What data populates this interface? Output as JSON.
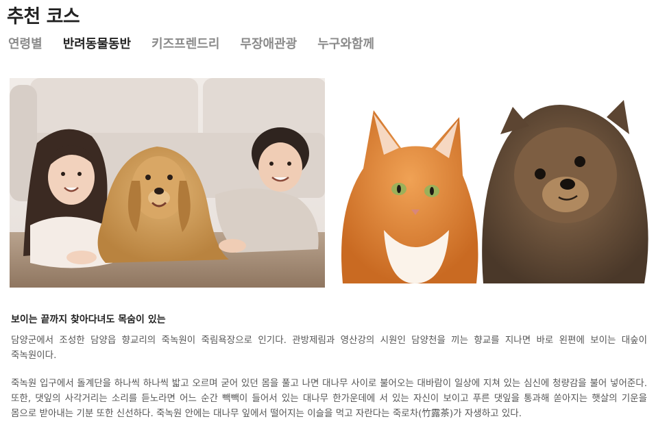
{
  "page": {
    "title": "추천 코스"
  },
  "tabs": [
    {
      "label": "연령별",
      "active": false
    },
    {
      "label": "반려동물동반",
      "active": true
    },
    {
      "label": "키즈프렌드리",
      "active": false
    },
    {
      "label": "무장애관광",
      "active": false
    },
    {
      "label": "누구와함께",
      "active": false
    }
  ],
  "article": {
    "heading": "보이는 끝까지 찾아다녀도 목숨이 있는",
    "paragraphs": [
      "담양군에서 조성한 담양읍 향교리의 죽녹원이 죽림욕장으로 인기다. 관방제림과 영산강의 시원인 담양천을 끼는 향교를 지나면 바로 왼편에 보이는 대숲이 죽녹원이다.",
      "죽녹원 입구에서 돌계단을 하나씩 하나씩 밟고 오르며 굳어 있던 몸을 풀고 나면 대나무 사이로 불어오는 대바람이 일상에 지쳐 있는 심신에 청량감을 불어 넣어준다. 또한, 댓잎의 사각거리는 소리를 듣노라면 어느 순간 빽빽이 들어서 있는 대나무 한가운데에 서 있는 자신이 보이고 푸른 댓잎을 통과해 쏟아지는 햇살의 기운을 몸으로 받아내는 기분 또한 신선하다. 죽녹원 안에는 대나무 잎에서 떨어지는 이슬을 먹고 자란다는 죽로차(竹露茶)가 자생하고 있다."
    ]
  },
  "colors": {
    "title": "#222222",
    "tab_inactive": "#8a8a8a",
    "tab_active": "#222222",
    "body_text": "#555555"
  }
}
